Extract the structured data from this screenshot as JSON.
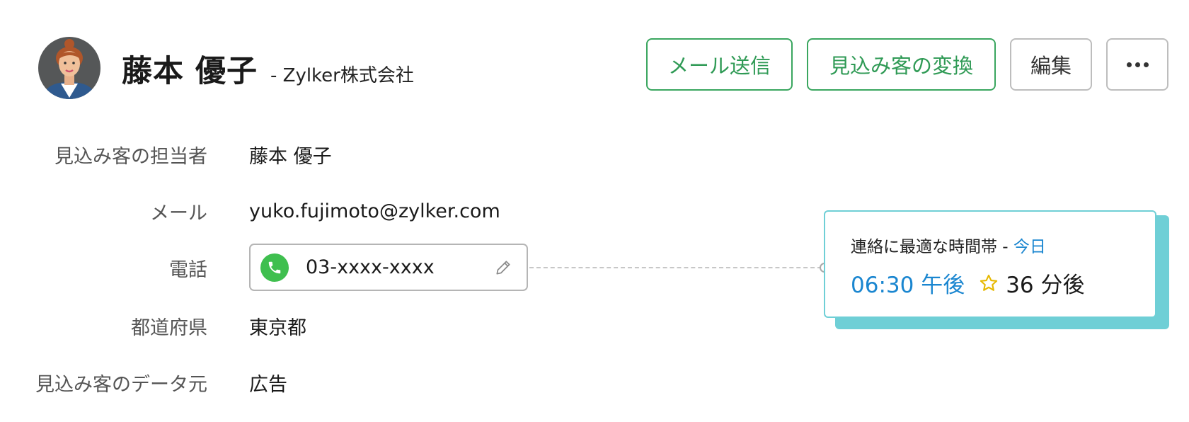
{
  "header": {
    "name": "藤本 優子",
    "company": "- Zylker株式会社"
  },
  "actions": {
    "send_mail": "メール送信",
    "convert": "見込み客の変換",
    "edit": "編集"
  },
  "fields": {
    "owner": {
      "label": "見込み客の担当者",
      "value": "藤本 優子"
    },
    "email": {
      "label": "メール",
      "value": "yuko.fujimoto@zylker.com"
    },
    "phone": {
      "label": "電話",
      "value": "03-xxxx-xxxx"
    },
    "prefecture": {
      "label": "都道府県",
      "value": "東京都"
    },
    "source": {
      "label": "見込み客のデータ元",
      "value": "広告"
    }
  },
  "best_time": {
    "title": "連絡に最適な時間帯 - ",
    "day": "今日",
    "time": "06:30 午後",
    "remaining": "36 分後"
  },
  "colors": {
    "green_accent": "#3aa65f",
    "link_blue": "#1a86d0",
    "card_teal": "#6fcfd6",
    "phone_green": "#3fbf4f",
    "star_gold": "#e6b800"
  },
  "icons": {
    "avatar": "avatar",
    "phone": "phone-icon",
    "edit": "pencil-icon",
    "more": "more-icon",
    "star": "star-icon"
  }
}
